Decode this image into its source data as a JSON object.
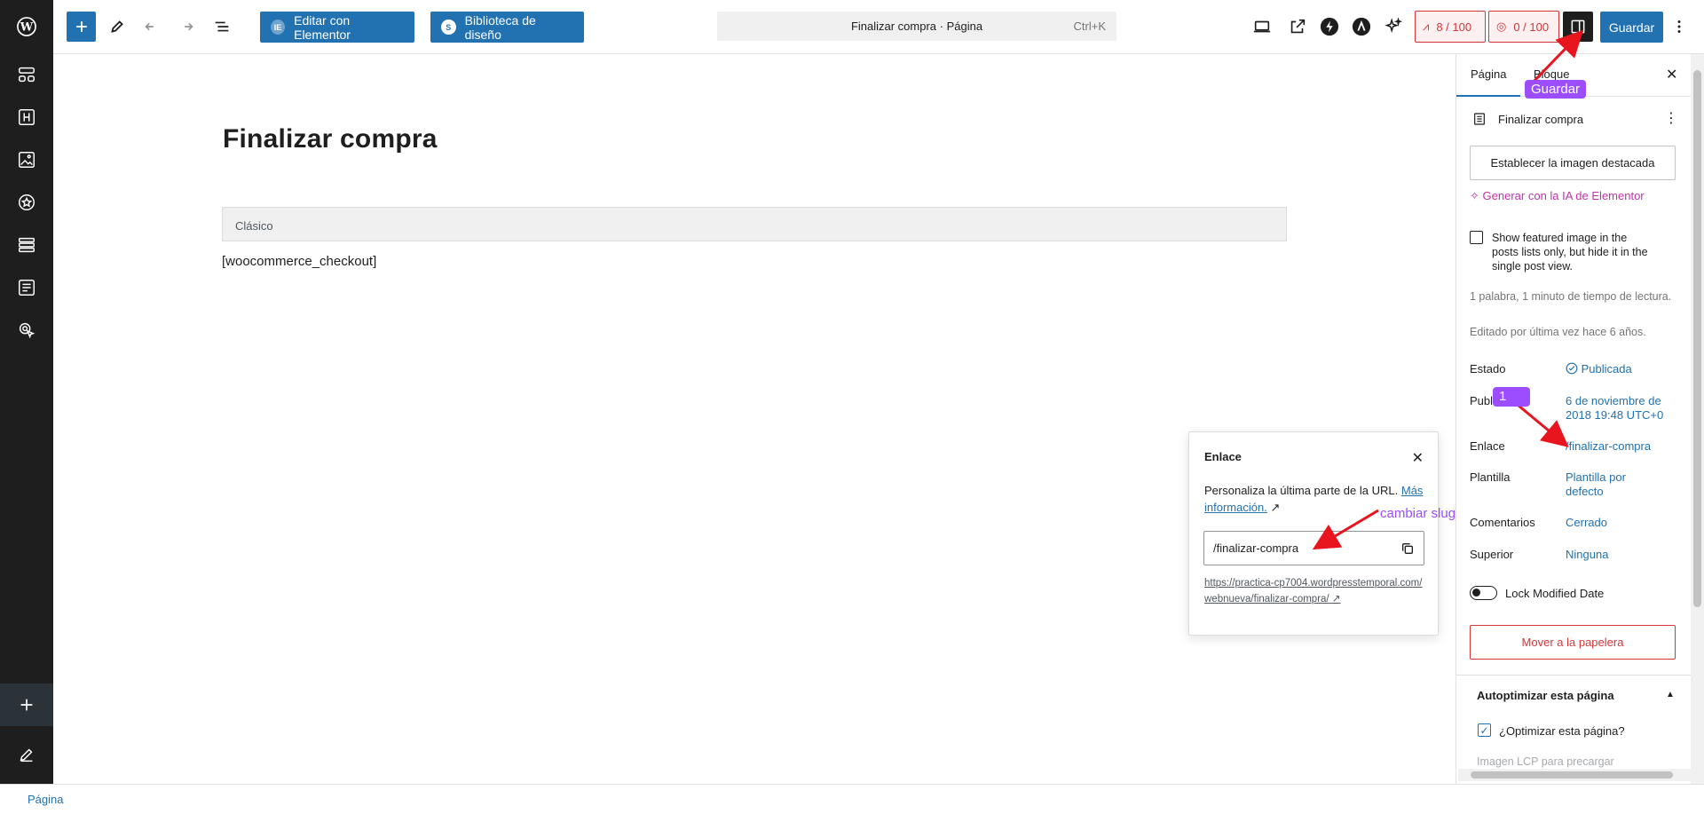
{
  "colors": {
    "accent": "#2271b1",
    "rail": "#1e1e1e",
    "danger": "#d63638",
    "annotation": "#9b4dff",
    "annotation_arrow": "#e8141e",
    "elementor_pink": "#c033a8"
  },
  "rail": {
    "items": [
      "wordpress-logo-icon",
      "blocks-icon",
      "heading-icon",
      "image-icon",
      "star-icon",
      "layout-icon",
      "form-icon",
      "pointer-icon"
    ],
    "bottom": [
      "plus-icon",
      "pencil-icon"
    ]
  },
  "topbar": {
    "edit_elementor": "Editar con Elementor",
    "design_library": "Biblioteca de diseño",
    "command": {
      "title": "Finalizar compra · Página",
      "shortcut": "Ctrl+K"
    },
    "score_seo": "8 / 100",
    "score_readability": "0 / 100",
    "save": "Guardar"
  },
  "editor": {
    "title": "Finalizar compra",
    "classic_label": "Clásico",
    "shortcode": "[woocommerce_checkout]"
  },
  "popover": {
    "heading": "Enlace",
    "desc": "Personaliza la última parte de la URL.",
    "more_link": "Más información.",
    "slug": "/finalizar-compra",
    "url": "https://practica-cp7004.wordpresstemporal.com/webnueva/finalizar-compra/"
  },
  "sidebar": {
    "tab_page": "Página",
    "tab_block": "Bloque",
    "doc_title": "Finalizar compra",
    "featured_image_btn": "Establecer la imagen destacada",
    "ai_link": "Generar con la IA de Elementor",
    "checkbox_label": "Show featured image in the posts lists only, but hide it in the single post view.",
    "stats": "1 palabra, 1 minuto de tiempo de lectura.",
    "edited": "Editado por última vez hace 6 años.",
    "rows": [
      {
        "label": "Estado",
        "value": "Publicada"
      },
      {
        "label": "Publ",
        "value": "6 de noviembre de 2018 19:48 UTC+0"
      },
      {
        "label": "Enlace",
        "value": "/finalizar-compra"
      },
      {
        "label": "Plantilla",
        "value": "Plantilla por defecto"
      },
      {
        "label": "Comentarios",
        "value": "Cerrado"
      },
      {
        "label": "Superior",
        "value": "Ninguna"
      }
    ],
    "lock_modified": "Lock Modified Date",
    "trash": "Mover a la papelera",
    "autoptimize_heading": "Autoptimizar esta página",
    "optimize_label": "¿Optimizar esta página?",
    "lcp_label": "Imagen LCP para precargar"
  },
  "footer": {
    "breadcrumb": "Página"
  },
  "annotations": {
    "save_tag": "Guardar",
    "step_tag": "1",
    "slug_note": "cambiar slug"
  }
}
